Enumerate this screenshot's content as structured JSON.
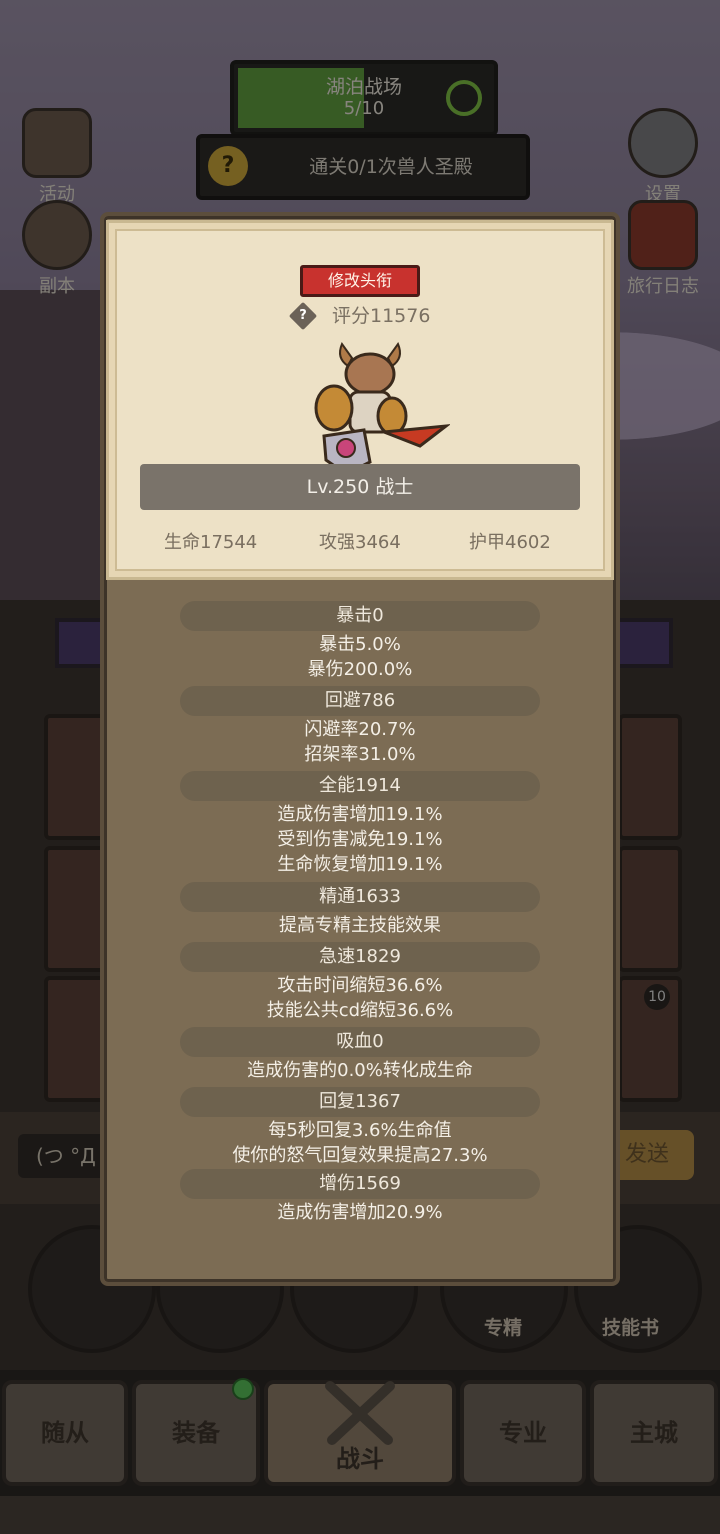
{
  "hud": {
    "stage_title": "湖泊战场",
    "stage_progress": "5/10",
    "stage_progress_fraction": 0.5,
    "quest_text": "通关0/1次兽人圣殿",
    "side_left": [
      "活动",
      "副本"
    ],
    "side_right": [
      "设置",
      "旅行日志"
    ]
  },
  "background": {
    "chat_input": "(つ °Д °",
    "send_label": "发送",
    "circle_labels": [
      "专精",
      "技能书"
    ],
    "card_badge": "10"
  },
  "nav": {
    "tabs": [
      "随从",
      "装备",
      "战斗",
      "专业",
      "主城"
    ],
    "active": "战斗"
  },
  "panel": {
    "title_button": "修改头衔",
    "score": "评分11576",
    "level_class": "Lv.250 战士",
    "base_stats": [
      "生命17544",
      "攻强3464",
      "护甲4602"
    ],
    "stat_groups": [
      {
        "header": "暴击0",
        "lines": [
          "暴击5.0%",
          "暴伤200.0%"
        ]
      },
      {
        "header": "回避786",
        "lines": [
          "闪避率20.7%",
          "招架率31.0%"
        ]
      },
      {
        "header": "全能1914",
        "lines": [
          "造成伤害增加19.1%",
          "受到伤害减免19.1%",
          "生命恢复增加19.1%"
        ]
      },
      {
        "header": "精通1633",
        "lines": [
          "提高专精主技能效果"
        ]
      },
      {
        "header": "急速1829",
        "lines": [
          "攻击时间缩短36.6%",
          "技能公共cd缩短36.6%"
        ]
      },
      {
        "header": "吸血0",
        "lines": [
          "造成伤害的0.0%转化成生命"
        ]
      },
      {
        "header": "回复1367",
        "lines": [
          "每5秒回复3.6%生命值",
          "使你的怒气回复效果提高27.3%"
        ]
      },
      {
        "header": "增伤1569",
        "lines": [
          "造成伤害增加20.9%"
        ]
      }
    ]
  }
}
